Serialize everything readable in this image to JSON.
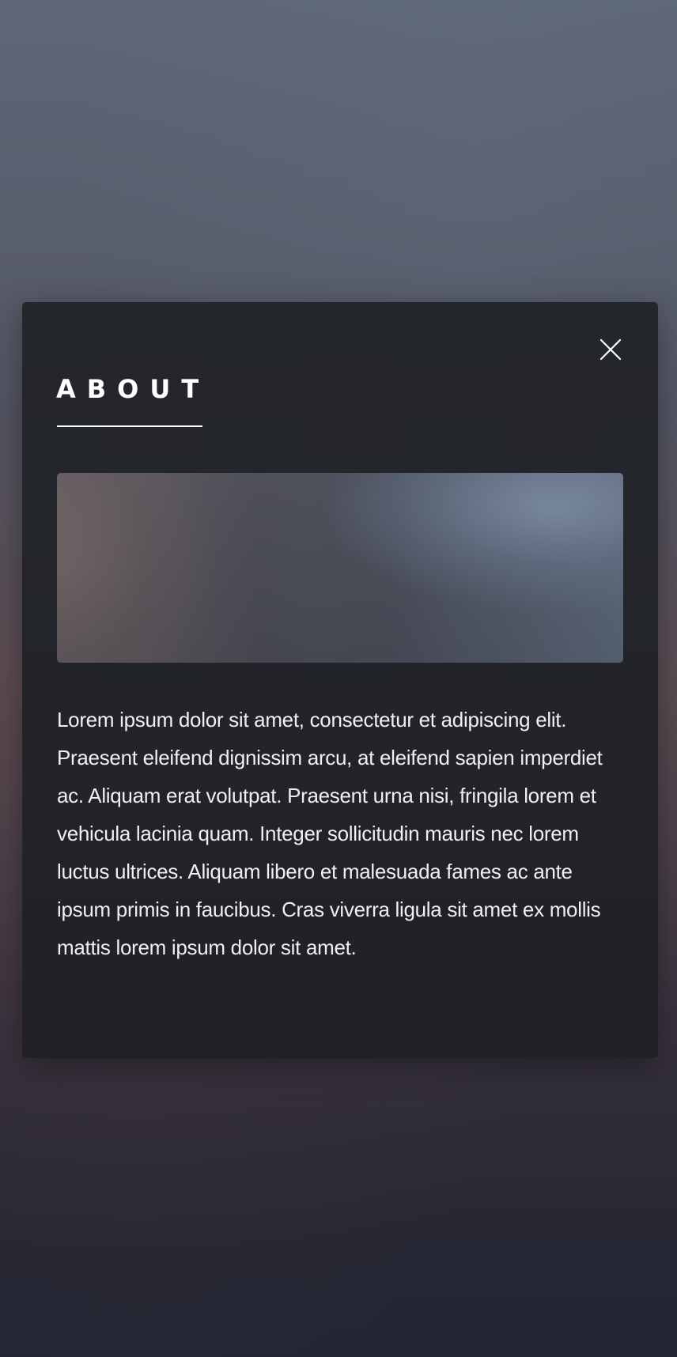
{
  "modal": {
    "title": "ABOUT",
    "close_icon": "close-icon",
    "image_alt_icon": "hero-image",
    "paragraph": "Lorem ipsum dolor sit amet, consectetur et adipiscing elit. Praesent eleifend dignissim arcu, at eleifend sapien imperdiet ac. Aliquam erat volutpat. Praesent urna nisi, fringila lorem et vehicula lacinia quam. Integer sollicitudin mauris nec lorem luctus ultrices. Aliquam libero et malesuada fames ac ante ipsum primis in faucibus. Cras viverra ligula sit amet ex mollis mattis lorem ipsum dolor sit amet."
  },
  "colors": {
    "modal_background": "#24272c",
    "text": "#ffffff",
    "backdrop_top": "#5d6777",
    "backdrop_bottom": "#232633"
  }
}
